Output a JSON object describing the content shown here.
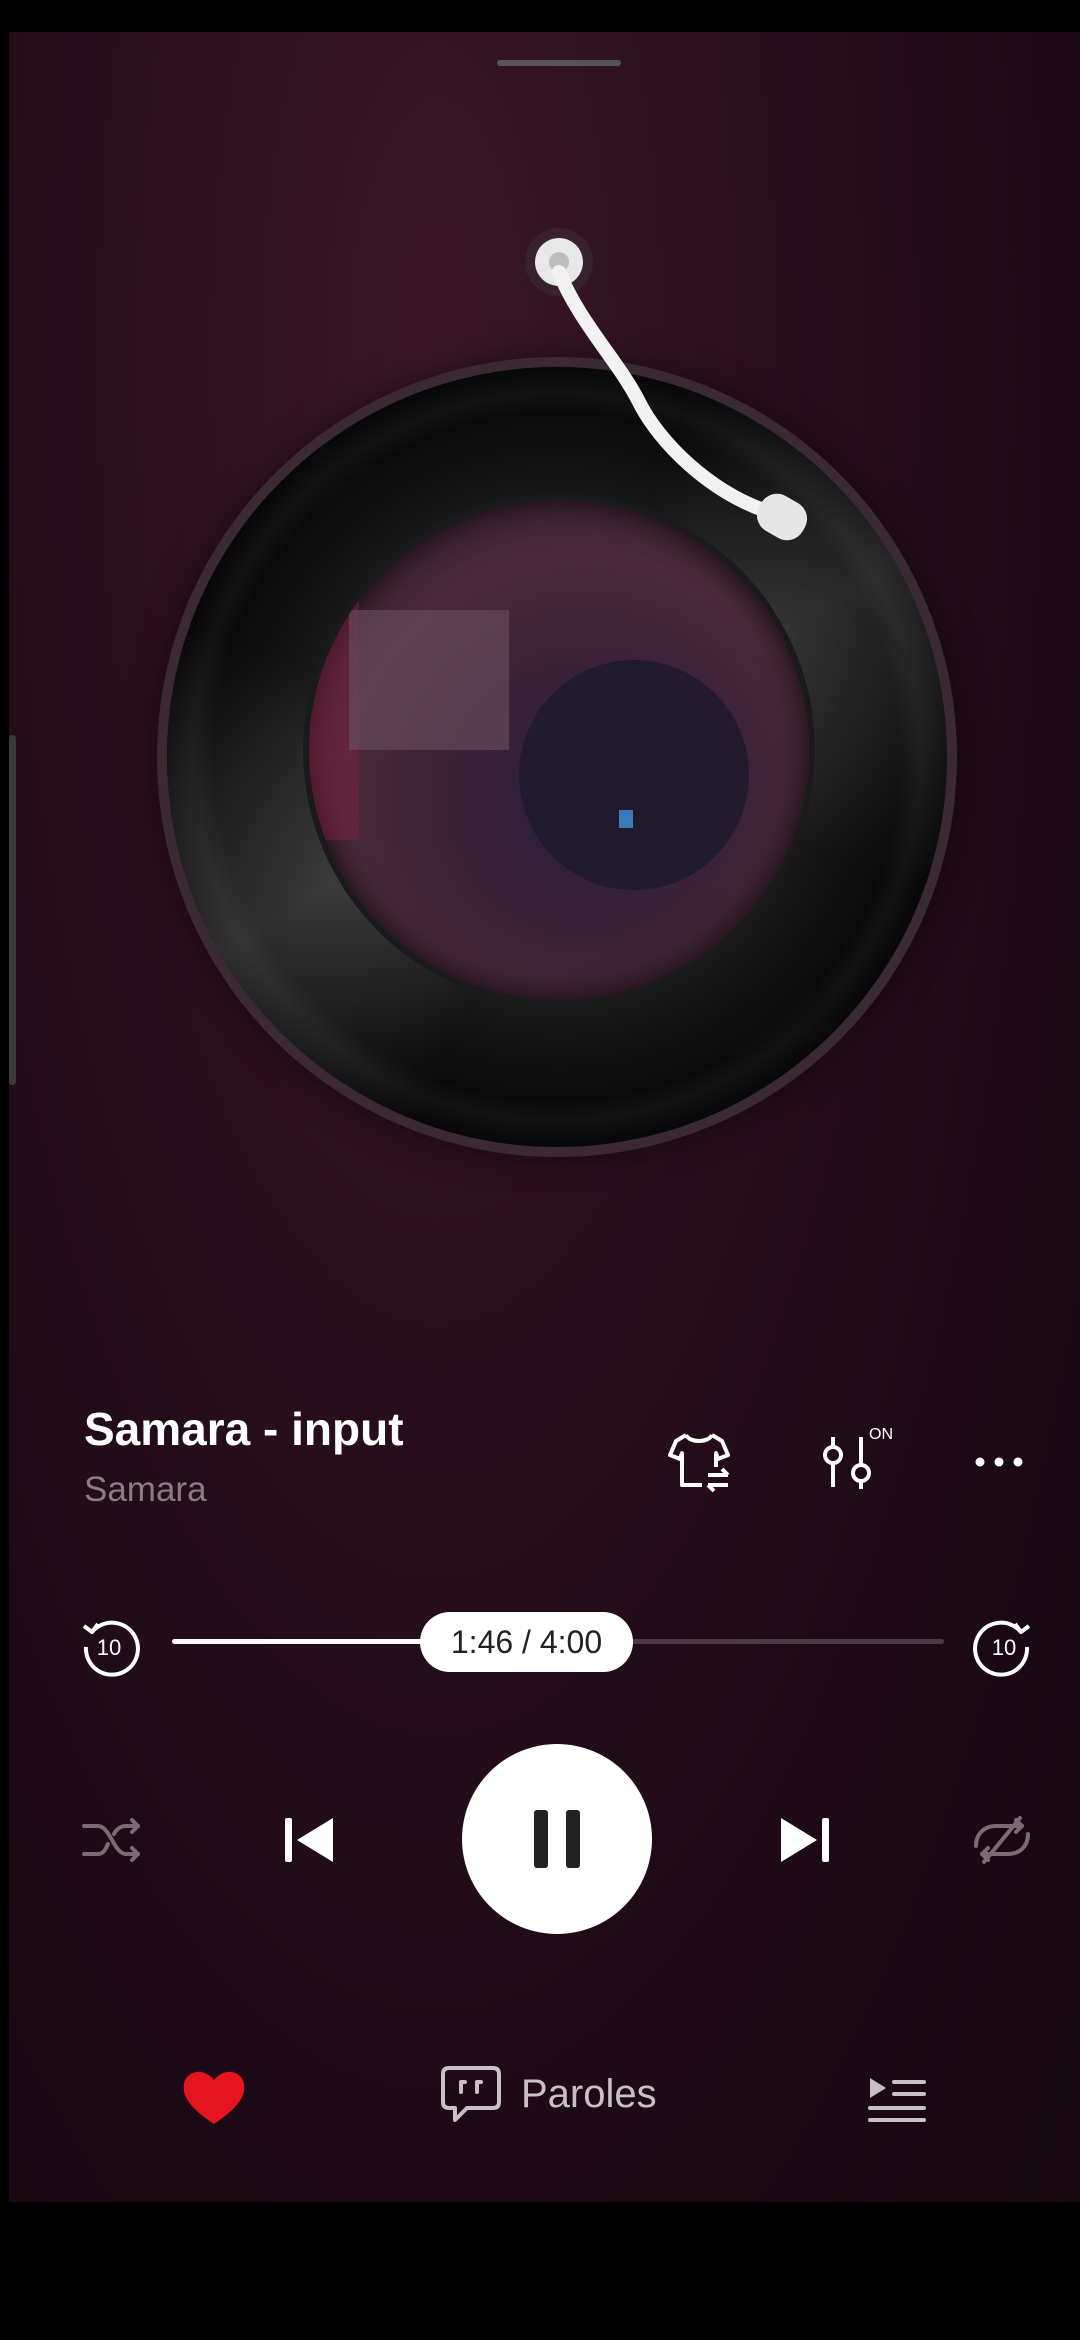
{
  "track": {
    "title": "Samara - input",
    "artist": "Samara"
  },
  "player": {
    "time_display": "1:46 / 4:00",
    "progress_fraction": 0.4417,
    "rewind_seconds": "10",
    "forward_seconds": "10",
    "equalizer_state": "ON",
    "state": "playing"
  },
  "bottom_bar": {
    "lyrics_label": "Paroles",
    "liked": true
  },
  "icons": {
    "rewind": "replay-10-icon",
    "forward": "forward-10-icon",
    "shuffle": "shuffle-icon",
    "previous": "skip-previous-icon",
    "pause": "pause-icon",
    "next": "skip-next-icon",
    "repeat": "repeat-off-icon",
    "like": "heart-icon",
    "lyrics": "lyrics-chat-icon",
    "queue": "queue-icon",
    "theme": "tshirt-swap-icon",
    "eq": "equalizer-icon",
    "more": "more-horizontal-icon"
  },
  "colors": {
    "accent_heart": "#e5141e",
    "background": "#1d0a16"
  }
}
